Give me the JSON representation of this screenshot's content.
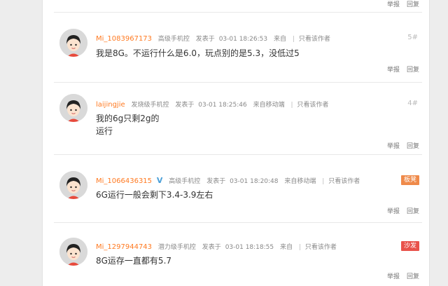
{
  "top_actions": {
    "report": "举报",
    "reply": "回复"
  },
  "posts": [
    {
      "username": "Mi_1083967173",
      "level": "高级手机控",
      "posted_prefix": "发表于",
      "datetime": "03-01 18:26:53",
      "source": "来自",
      "only_author": "只看该作者",
      "floor": "5#",
      "lines": [
        "我是8G。不运行什么是6.0，玩点别的是5.3，没低过5"
      ],
      "report": "举报",
      "reply": "回复"
    },
    {
      "username": "laijingjie",
      "level": "发烧级手机控",
      "posted_prefix": "发表于",
      "datetime": "03-01 18:25:46",
      "source": "来自移动端",
      "only_author": "只看该作者",
      "floor": "4#",
      "lines": [
        "我的6g只剩2g的",
        "运行"
      ],
      "report": "举报",
      "reply": "回复"
    },
    {
      "username": "Mi_1066436315",
      "verified_mark": "V",
      "level": "高级手机控",
      "posted_prefix": "发表于",
      "datetime": "03-01 18:20:48",
      "source": "来自移动端",
      "only_author": "只看该作者",
      "badge": "板凳",
      "badge_color": "#ef8a4a",
      "lines": [
        "6G运行一般会剩下3.4-3.9左右"
      ],
      "report": "举报",
      "reply": "回复"
    },
    {
      "username": "Mi_1297944743",
      "level": "潜力级手机控",
      "posted_prefix": "发表于",
      "datetime": "03-01 18:18:55",
      "source": "来自",
      "only_author": "只看该作者",
      "badge": "沙发",
      "badge_color": "#e8524b",
      "lines": [
        "8G运存一直都有5.7"
      ],
      "report": "举报",
      "reply": "回复"
    }
  ]
}
